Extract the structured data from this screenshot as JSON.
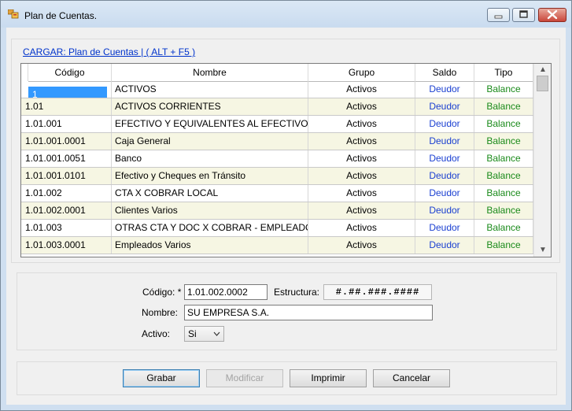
{
  "window": {
    "title": "Plan de Cuentas."
  },
  "link": {
    "text": "CARGAR: Plan de Cuentas | ( ALT + F5 )"
  },
  "grid": {
    "columns": [
      "Código",
      "Nombre",
      "Grupo",
      "Saldo",
      "Tipo"
    ],
    "rows": [
      {
        "code": "1",
        "name": "ACTIVOS",
        "group": "Activos",
        "saldo": "Deudor",
        "tipo": "Balance"
      },
      {
        "code": "1.01",
        "name": "ACTIVOS CORRIENTES",
        "group": "Activos",
        "saldo": "Deudor",
        "tipo": "Balance"
      },
      {
        "code": "1.01.001",
        "name": "EFECTIVO Y EQUIVALENTES AL EFECTIVO",
        "group": "Activos",
        "saldo": "Deudor",
        "tipo": "Balance"
      },
      {
        "code": "1.01.001.0001",
        "name": "Caja General",
        "group": "Activos",
        "saldo": "Deudor",
        "tipo": "Balance"
      },
      {
        "code": "1.01.001.0051",
        "name": "Banco",
        "group": "Activos",
        "saldo": "Deudor",
        "tipo": "Balance"
      },
      {
        "code": "1.01.001.0101",
        "name": "Efectivo y Cheques en Tránsito",
        "group": "Activos",
        "saldo": "Deudor",
        "tipo": "Balance"
      },
      {
        "code": "1.01.002",
        "name": "CTA X COBRAR LOCAL",
        "group": "Activos",
        "saldo": "Deudor",
        "tipo": "Balance"
      },
      {
        "code": "1.01.002.0001",
        "name": "Clientes Varios",
        "group": "Activos",
        "saldo": "Deudor",
        "tipo": "Balance"
      },
      {
        "code": "1.01.003",
        "name": "OTRAS CTA Y DOC X COBRAR - EMPLEADOS",
        "group": "Activos",
        "saldo": "Deudor",
        "tipo": "Balance"
      },
      {
        "code": "1.01.003.0001",
        "name": "Empleados Varios",
        "group": "Activos",
        "saldo": "Deudor",
        "tipo": "Balance"
      }
    ]
  },
  "form": {
    "codigo_label": "Código:",
    "required_mark": "*",
    "codigo_value": "1.01.002.0002",
    "estructura_label": "Estructura:",
    "estructura_value": "#.##.###.####",
    "nombre_label": "Nombre:",
    "nombre_value": "SU EMPRESA S.A.",
    "activo_label": "Activo:",
    "activo_value": "Si"
  },
  "buttons": {
    "grabar": "Grabar",
    "modificar": "Modificar",
    "imprimir": "Imprimir",
    "cancelar": "Cancelar"
  },
  "colors": {
    "saldo": "#1a3fd1",
    "tipo": "#1a8a1a",
    "alt_row": "#f6f6e3",
    "selected": "#3399ff"
  }
}
